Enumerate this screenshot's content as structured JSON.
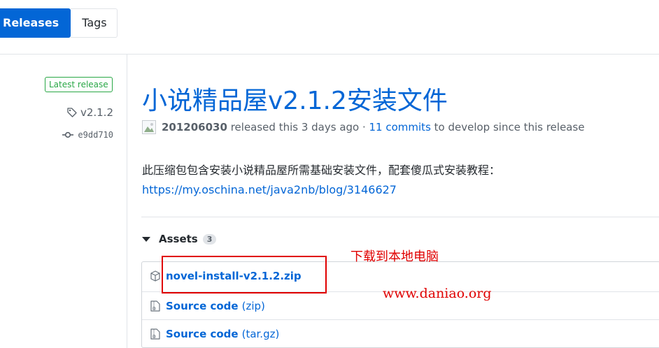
{
  "tabs": {
    "releases": "Releases",
    "tags": "Tags"
  },
  "sidebar": {
    "latest_badge": "Latest release",
    "tag": "v2.1.2",
    "commit": "e9dd710"
  },
  "release": {
    "title": "小说精品屋v2.1.2安装文件",
    "author": "201206030",
    "released_text": " released this 3 days ago · ",
    "commits_link": "11 commits",
    "commits_suffix": " to develop since this release",
    "description": "此压缩包包含安装小说精品屋所需基础安装文件，配套傻瓜式安装教程：",
    "url": "https://my.oschina.net/java2nb/blog/3146627"
  },
  "assets": {
    "heading": "Assets",
    "count": "3",
    "items": [
      {
        "name": "novel-install-v2.1.2.zip",
        "ext": ""
      },
      {
        "name": "Source code",
        "ext": "(zip)"
      },
      {
        "name": "Source code",
        "ext": "(tar.gz)"
      }
    ]
  },
  "annotations": {
    "download_note": "下载到本地电脑",
    "watermark": "www.daniao.org"
  },
  "colors": {
    "accent": "#0366d6",
    "success": "#28a745",
    "annotation": "#e00000"
  }
}
